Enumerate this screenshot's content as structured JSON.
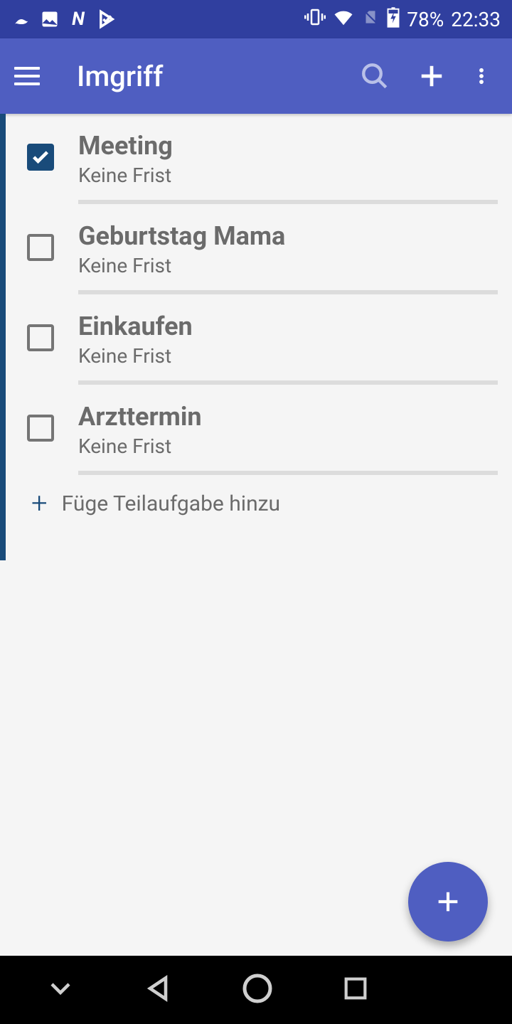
{
  "status_bar": {
    "battery_text": "78%",
    "time": "22:33"
  },
  "app_bar": {
    "title": "Imgriff"
  },
  "tasks": [
    {
      "title": "Meeting",
      "subtitle": "Keine Frist",
      "checked": true
    },
    {
      "title": "Geburtstag Mama",
      "subtitle": "Keine Frist",
      "checked": false
    },
    {
      "title": "Einkaufen",
      "subtitle": "Keine Frist",
      "checked": false
    },
    {
      "title": "Arzttermin",
      "subtitle": "Keine Frist",
      "checked": false
    }
  ],
  "add_subtask_label": "Füge Teilaufgabe hinzu"
}
